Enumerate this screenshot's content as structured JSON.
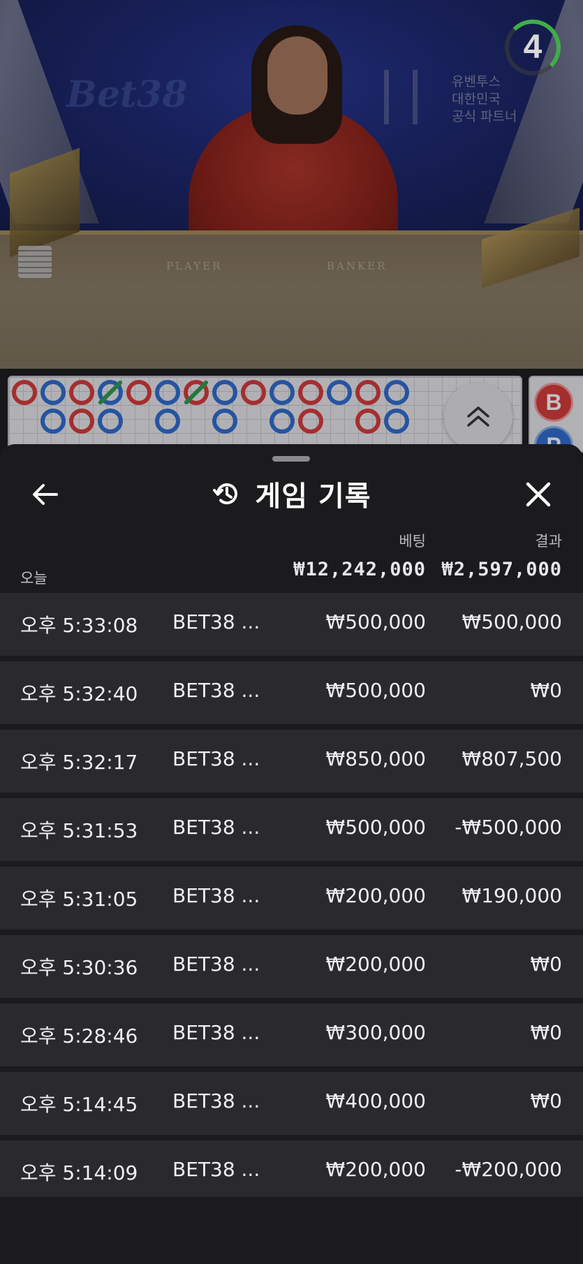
{
  "video": {
    "timer_value": "4",
    "brand_logo_text": "Bet38",
    "partner_text": "유벤투스\n대한민국\n공식 파트너",
    "table_player_label": "PLAYER",
    "table_banker_label": "BANKER"
  },
  "road": {
    "beads_top": [
      "b",
      "p",
      "b",
      "p",
      "b",
      "p",
      "b",
      "p",
      "b",
      "p",
      "b",
      "p",
      "b",
      "p"
    ],
    "beads_mid": [
      "",
      "p",
      "b",
      "p",
      "",
      "p",
      "",
      "p",
      "",
      "p",
      "b",
      "",
      "b",
      "p"
    ],
    "side_b": "B",
    "side_p": "P"
  },
  "sheet": {
    "title": "게임 기록",
    "bet_label": "베팅",
    "result_label": "결과",
    "today_label": "오늘",
    "bet_total": "₩12,242,000",
    "result_total": "₩2,597,000"
  },
  "rows": [
    {
      "time": "오후 5:33:08",
      "game": "BET38 ...",
      "bet": "₩500,000",
      "result": "₩500,000"
    },
    {
      "time": "오후 5:32:40",
      "game": "BET38 ...",
      "bet": "₩500,000",
      "result": "₩0"
    },
    {
      "time": "오후 5:32:17",
      "game": "BET38 ...",
      "bet": "₩850,000",
      "result": "₩807,500"
    },
    {
      "time": "오후 5:31:53",
      "game": "BET38 ...",
      "bet": "₩500,000",
      "result": "-₩500,000"
    },
    {
      "time": "오후 5:31:05",
      "game": "BET38 ...",
      "bet": "₩200,000",
      "result": "₩190,000"
    },
    {
      "time": "오후 5:30:36",
      "game": "BET38 ...",
      "bet": "₩200,000",
      "result": "₩0"
    },
    {
      "time": "오후 5:28:46",
      "game": "BET38 ...",
      "bet": "₩300,000",
      "result": "₩0"
    },
    {
      "time": "오후 5:14:45",
      "game": "BET38 ...",
      "bet": "₩400,000",
      "result": "₩0"
    },
    {
      "time": "오후 5:14:09",
      "game": "BET38 ...",
      "bet": "₩200,000",
      "result": "-₩200,000"
    }
  ],
  "colors": {
    "banker": "#d83a3a",
    "player": "#2f6dd0",
    "timer_ring": "#3fae49",
    "sheet_bg": "#1b1b1d",
    "row_bg": "#2a2a2d"
  },
  "icons": {
    "back": "arrow-left-icon",
    "history": "history-icon",
    "close": "close-icon",
    "expand": "chevron-double-up-icon"
  }
}
